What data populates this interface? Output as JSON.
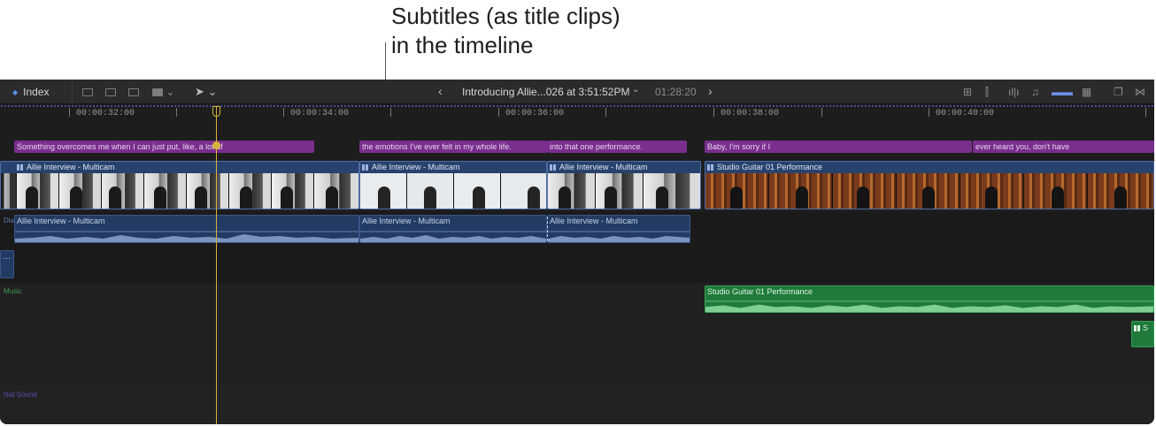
{
  "callout": {
    "line1": "Subtitles (as title clips)",
    "line2": "in the timeline"
  },
  "toolbar": {
    "index_label": "Index",
    "project_title": "Introducing Allie...026 at 3:51:52PM",
    "duration": "01:28:20"
  },
  "ruler": {
    "timecodes": [
      "00:00:32:00",
      "00:00:34:00",
      "00:00:36:00",
      "00:00:38:00",
      "00:00:40:00"
    ]
  },
  "captions": [
    "Something overcomes me when I can just put, like, a lot of",
    "the emotions I've ever felt in my whole life.",
    "into that one performance.",
    "Baby, I'm sorry if I",
    "ever heard you, don't have"
  ],
  "video_clips": [
    "Allie Interview - Multicam",
    "Allie Interview - Multicam",
    "Allie Interview - Multicam",
    "Studio Guitar 01 Performance"
  ],
  "audio_clips": [
    "Allie Interview - Multicam",
    "Allie Interview - Multicam",
    "Allie Interview - Multicam"
  ],
  "music_clip": "Studio Guitar 01 Performance",
  "small_clip_label": "S",
  "lanes": {
    "dialogue": "Dia",
    "music": "Music",
    "nat_sound": "Nat Sound",
    "ellipsis": "···"
  },
  "colors": {
    "caption": "#7a2e8e",
    "video": "#28426e",
    "music": "#1f7a3b",
    "playhead": "#d9b33a"
  }
}
